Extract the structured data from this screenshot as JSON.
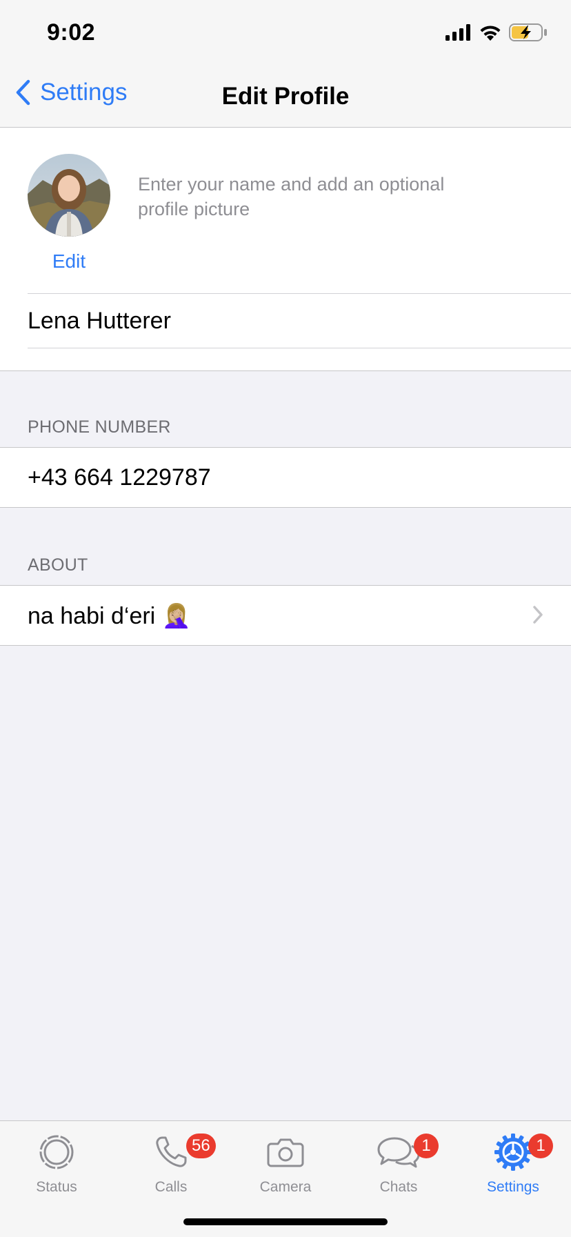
{
  "status_bar": {
    "time": "9:02"
  },
  "nav": {
    "back_label": "Settings",
    "title": "Edit Profile"
  },
  "profile": {
    "edit_label": "Edit",
    "hint": "Enter your name and add an optional profile picture",
    "name": "Lena Hutterer"
  },
  "phone": {
    "header": "PHONE NUMBER",
    "value": "+43 664 1229787"
  },
  "about": {
    "header": "ABOUT",
    "value": "na habi d‘eri 🤦🏼‍♀️"
  },
  "tabs": [
    {
      "label": "Status",
      "icon": "status-icon"
    },
    {
      "label": "Calls",
      "icon": "phone-icon",
      "badge": "56"
    },
    {
      "label": "Camera",
      "icon": "camera-icon"
    },
    {
      "label": "Chats",
      "icon": "chat-bubbles-icon",
      "badge": "1"
    },
    {
      "label": "Settings",
      "icon": "gear-icon",
      "badge": "1",
      "active": true
    }
  ],
  "colors": {
    "accent": "#2f7cf6",
    "badge": "#ea3b2e",
    "background": "#f2f2f7"
  }
}
